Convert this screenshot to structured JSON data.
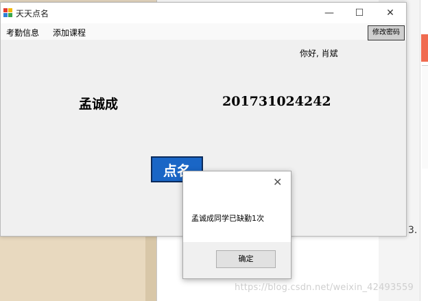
{
  "window": {
    "title": "天天点名",
    "controls": {
      "minimize": "—",
      "maximize": "☐",
      "close": "✕"
    }
  },
  "menu": {
    "items": [
      "考勤信息",
      "添加课程"
    ]
  },
  "toolbar": {
    "change_password": "修改密码"
  },
  "main": {
    "greeting": "你好, 肖斌",
    "student_name": "孟诚成",
    "student_id": "201731024242",
    "roll_call_button": "点名"
  },
  "dialog": {
    "message": "孟诚成同学已缺勤1次",
    "ok_button": "确定",
    "close": "✕"
  },
  "background": {
    "page_number": "3.",
    "watermark": "https://blog.csdn.net/weixin_42493559"
  },
  "colors": {
    "accent_button": "#1a66c6",
    "window_bg": "#f0f0f0"
  }
}
